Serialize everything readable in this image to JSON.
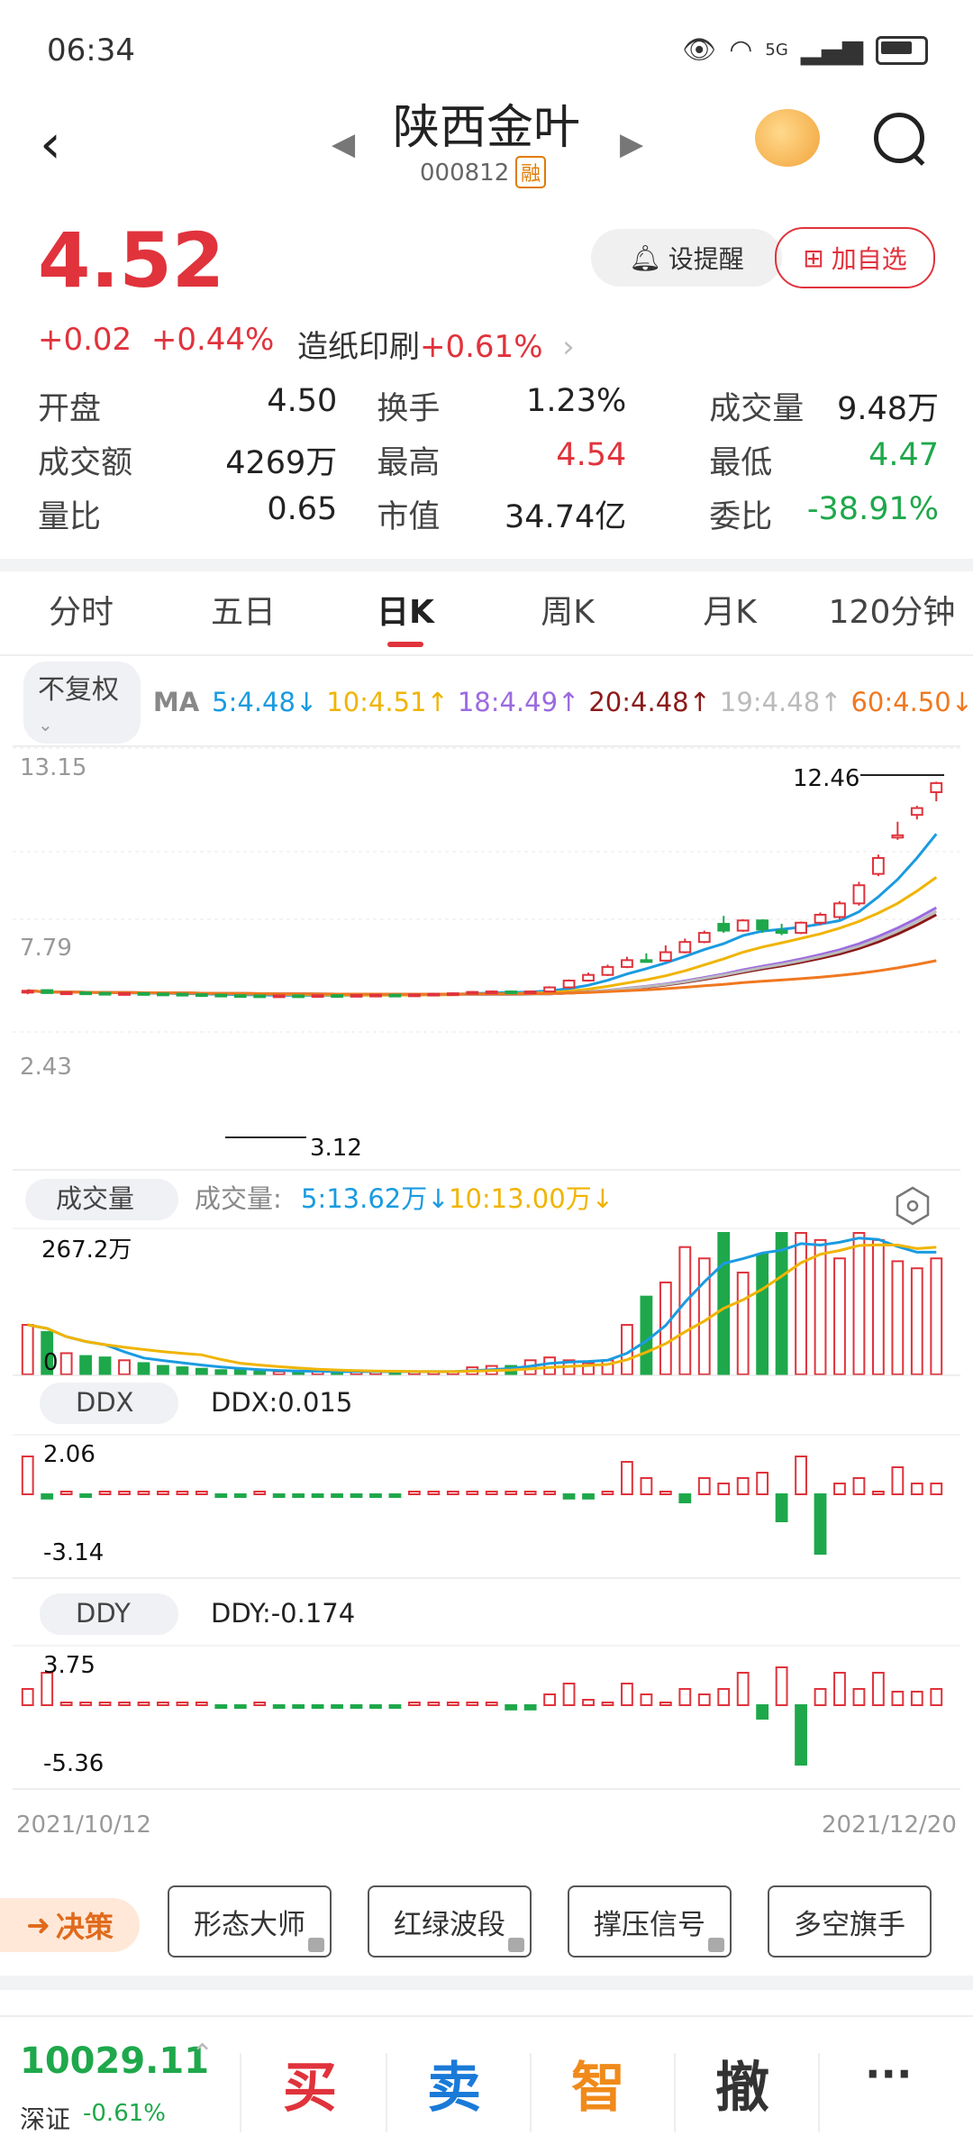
{
  "status": {
    "time": "06:34",
    "network": "5G"
  },
  "header": {
    "title": "陕西金叶",
    "code": "000812",
    "margin_badge": "融"
  },
  "quote": {
    "price": "4.52",
    "change": "+0.02",
    "change_pct": "+0.44%",
    "sector": "造纸印刷",
    "sector_pct": "+0.61%",
    "alert_label": "设提醒",
    "add_label": "加自选"
  },
  "stats": [
    [
      {
        "label": "开盘",
        "value": "4.50",
        "color": "neutral"
      },
      {
        "label": "换手",
        "value": "1.23%",
        "color": "neutral"
      },
      {
        "label": "成交量",
        "value": "9.48万",
        "color": "neutral"
      }
    ],
    [
      {
        "label": "成交额",
        "value": "4269万",
        "color": "neutral"
      },
      {
        "label": "最高",
        "value": "4.54",
        "color": "red"
      },
      {
        "label": "最低",
        "value": "4.47",
        "color": "green"
      }
    ],
    [
      {
        "label": "量比",
        "value": "0.65",
        "color": "neutral"
      },
      {
        "label": "市值",
        "value": "34.74亿",
        "color": "neutral"
      },
      {
        "label": "委比",
        "value": "-38.91%",
        "color": "green"
      }
    ]
  ],
  "tabs": [
    "分时",
    "五日",
    "日K",
    "周K",
    "月K",
    "120分钟"
  ],
  "active_tab": "日K",
  "ma": {
    "adjust": "不复权",
    "label": "MA",
    "items": [
      {
        "text": "5:4.48↓",
        "color": "#1a9be0"
      },
      {
        "text": "10:4.51↑",
        "color": "#f0b400"
      },
      {
        "text": "18:4.49↑",
        "color": "#9b6be0"
      },
      {
        "text": "20:4.48↑",
        "color": "#8b1a1a"
      },
      {
        "text": "19:4.48↑",
        "color": "#bbbbbb"
      },
      {
        "text": "60:4.50↓",
        "color": "#f07820"
      }
    ]
  },
  "kline": {
    "y_top_label": "13.15",
    "y_mid_label": "7.79",
    "y_bottom_label": "2.43",
    "high_label": "12.46",
    "low_label": "3.12"
  },
  "volume": {
    "selector": "成交量",
    "label": "成交量:",
    "ma5": "5:13.62万↓",
    "ma10": "10:13.00万↓",
    "top_label": "267.2万",
    "zero_label": "0"
  },
  "ddx": {
    "selector": "DDX",
    "value_text": "DDX:0.015",
    "top": "2.06",
    "bottom": "-3.14"
  },
  "ddy": {
    "selector": "DDY",
    "value_text": "DDY:-0.174",
    "top": "3.75",
    "bottom": "-5.36"
  },
  "dates": {
    "start": "2021/10/12",
    "end": "2021/12/20"
  },
  "tools": {
    "decision": "决策",
    "buttons": [
      "形态大师",
      "红绿波段",
      "撑压信号",
      "多空旗手"
    ]
  },
  "bottom": {
    "index_value": "10029.11",
    "index_name": "深证",
    "index_change": "-0.61%",
    "actions": [
      {
        "label": "买",
        "color": "#e0333c"
      },
      {
        "label": "卖",
        "color": "#1a7ad8"
      },
      {
        "label": "智",
        "color": "#f08a1a"
      },
      {
        "label": "撤",
        "color": "#333333"
      },
      {
        "label": "···",
        "color": "#333333"
      }
    ]
  },
  "chart_data": {
    "type": "candlestick",
    "x_start": "2021/10/12",
    "x_end": "2021/12/20",
    "ylim": [
      2.43,
      13.15
    ],
    "candles": [
      {
        "o": 3.2,
        "c": 3.25,
        "h": 3.3,
        "l": 3.1
      },
      {
        "o": 3.28,
        "c": 3.15,
        "h": 3.3,
        "l": 3.12
      },
      {
        "o": 3.15,
        "c": 3.18,
        "h": 3.22,
        "l": 3.1
      },
      {
        "o": 3.18,
        "c": 3.16,
        "h": 3.22,
        "l": 3.12
      },
      {
        "o": 3.16,
        "c": 3.14,
        "h": 3.2,
        "l": 3.1
      },
      {
        "o": 3.14,
        "c": 3.15,
        "h": 3.18,
        "l": 3.1
      },
      {
        "o": 3.15,
        "c": 3.13,
        "h": 3.18,
        "l": 3.1
      },
      {
        "o": 3.13,
        "c": 3.12,
        "h": 3.15,
        "l": 3.1
      },
      {
        "o": 3.12,
        "c": 3.1,
        "h": 3.14,
        "l": 3.06
      },
      {
        "o": 3.1,
        "c": 3.08,
        "h": 3.12,
        "l": 3.04
      },
      {
        "o": 3.08,
        "c": 3.06,
        "h": 3.1,
        "l": 3.02
      },
      {
        "o": 3.06,
        "c": 3.05,
        "h": 3.08,
        "l": 3.0
      },
      {
        "o": 3.05,
        "c": 3.04,
        "h": 3.07,
        "l": 3.0
      },
      {
        "o": 3.04,
        "c": 3.05,
        "h": 3.07,
        "l": 3.0
      },
      {
        "o": 3.05,
        "c": 3.04,
        "h": 3.07,
        "l": 3.0
      },
      {
        "o": 3.04,
        "c": 3.06,
        "h": 3.08,
        "l": 3.02
      },
      {
        "o": 3.06,
        "c": 3.05,
        "h": 3.08,
        "l": 3.02
      },
      {
        "o": 3.05,
        "c": 3.07,
        "h": 3.09,
        "l": 3.03
      },
      {
        "o": 3.07,
        "c": 3.08,
        "h": 3.1,
        "l": 3.04
      },
      {
        "o": 3.08,
        "c": 3.07,
        "h": 3.1,
        "l": 3.04
      },
      {
        "o": 3.07,
        "c": 3.09,
        "h": 3.11,
        "l": 3.05
      },
      {
        "o": 3.09,
        "c": 3.12,
        "h": 3.15,
        "l": 3.06
      },
      {
        "o": 3.12,
        "c": 3.14,
        "h": 3.18,
        "l": 3.08
      },
      {
        "o": 3.14,
        "c": 3.2,
        "h": 3.24,
        "l": 3.1
      },
      {
        "o": 3.2,
        "c": 3.22,
        "h": 3.26,
        "l": 3.16
      },
      {
        "o": 3.22,
        "c": 3.2,
        "h": 3.26,
        "l": 3.16
      },
      {
        "o": 3.2,
        "c": 3.22,
        "h": 3.25,
        "l": 3.16
      },
      {
        "o": 3.22,
        "c": 3.4,
        "h": 3.45,
        "l": 3.18
      },
      {
        "o": 3.4,
        "c": 3.7,
        "h": 3.75,
        "l": 3.35
      },
      {
        "o": 3.7,
        "c": 3.95,
        "h": 4.05,
        "l": 3.65
      },
      {
        "o": 3.95,
        "c": 4.3,
        "h": 4.4,
        "l": 3.9
      },
      {
        "o": 4.3,
        "c": 4.6,
        "h": 4.75,
        "l": 4.25
      },
      {
        "o": 4.6,
        "c": 4.58,
        "h": 4.9,
        "l": 4.5
      },
      {
        "o": 4.58,
        "c": 4.95,
        "h": 5.25,
        "l": 4.55
      },
      {
        "o": 4.95,
        "c": 5.4,
        "h": 5.55,
        "l": 4.9
      },
      {
        "o": 5.4,
        "c": 5.8,
        "h": 5.9,
        "l": 5.35
      },
      {
        "o": 6.2,
        "c": 5.9,
        "h": 6.55,
        "l": 5.8
      },
      {
        "o": 5.9,
        "c": 6.35,
        "h": 6.4,
        "l": 5.85
      },
      {
        "o": 6.35,
        "c": 5.95,
        "h": 6.4,
        "l": 5.8
      },
      {
        "o": 5.9,
        "c": 5.8,
        "h": 6.2,
        "l": 5.7
      },
      {
        "o": 5.8,
        "c": 6.25,
        "h": 6.3,
        "l": 5.75
      },
      {
        "o": 6.25,
        "c": 6.6,
        "h": 6.7,
        "l": 6.15
      },
      {
        "o": 6.5,
        "c": 7.1,
        "h": 7.2,
        "l": 6.4
      },
      {
        "o": 7.1,
        "c": 7.9,
        "h": 8.05,
        "l": 7.0
      },
      {
        "o": 8.4,
        "c": 9.1,
        "h": 9.25,
        "l": 8.3
      },
      {
        "o": 10.0,
        "c": 10.1,
        "h": 10.7,
        "l": 9.9
      },
      {
        "o": 11.0,
        "c": 11.3,
        "h": 11.4,
        "l": 10.8
      },
      {
        "o": 12.0,
        "c": 12.4,
        "h": 12.46,
        "l": 11.6
      }
    ],
    "volume_max": "267.2万"
  }
}
